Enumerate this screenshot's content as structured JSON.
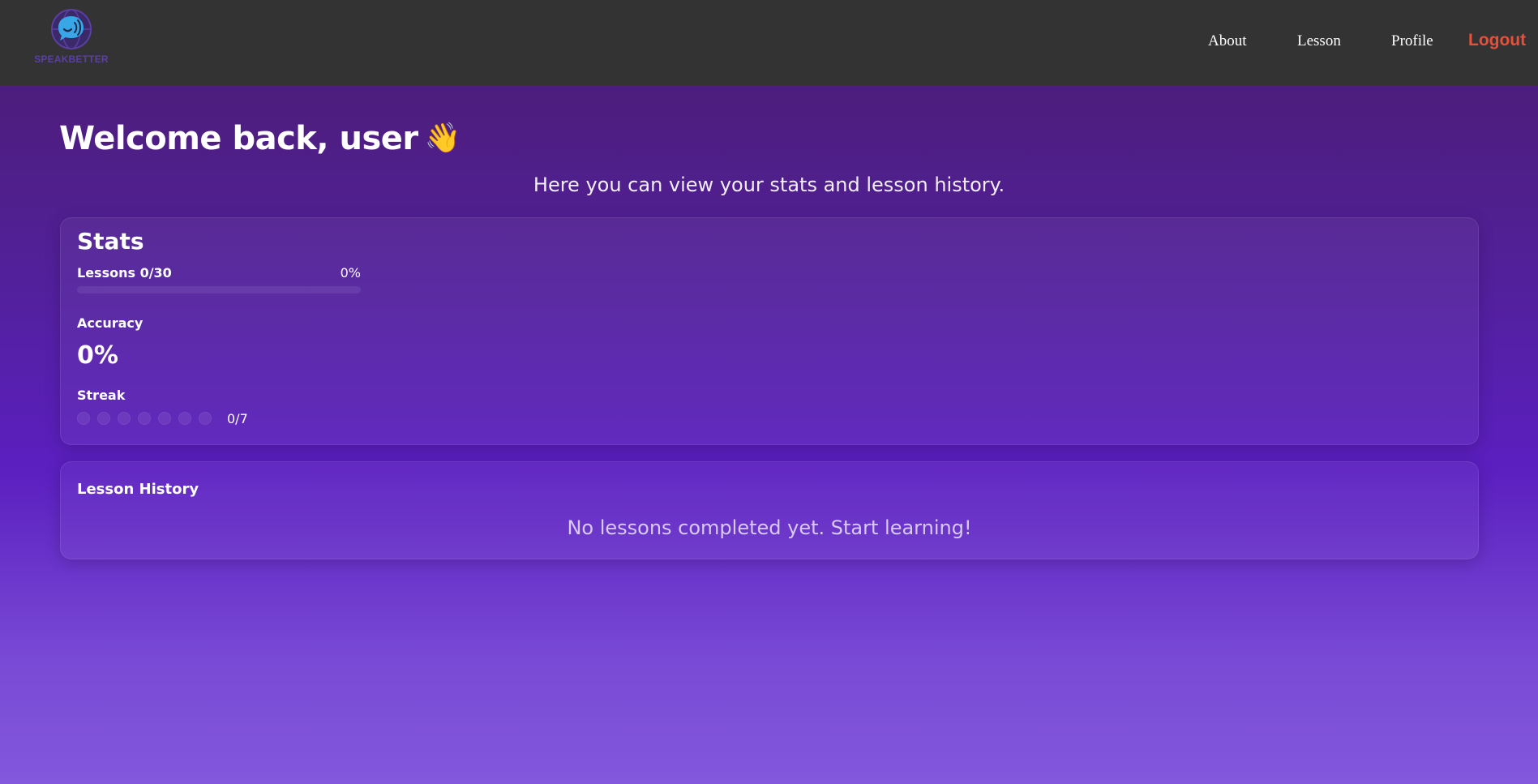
{
  "header": {
    "logo_text": "SPEAKBETTER",
    "nav": {
      "about": "About",
      "lesson": "Lesson",
      "profile": "Profile",
      "logout": "Logout"
    },
    "colors": {
      "background": "#333333",
      "logout": "#e8503a",
      "logo_text": "#5b3fa3"
    }
  },
  "greeting": {
    "title": "Welcome back, user",
    "wave_icon": "👋",
    "subtitle": "Here you can view your stats and lesson history."
  },
  "stats": {
    "title": "Stats",
    "lessons_label": "Lessons 0/30",
    "lessons_percent_text": "0%",
    "lessons_progress_fraction": 0,
    "accuracy_label": "Accuracy",
    "accuracy_value": "0%",
    "streak_label": "Streak",
    "streak_days_total": 7,
    "streak_days_done": 0,
    "streak_count_text": "0/7"
  },
  "history": {
    "title": "Lesson History",
    "empty_message": "No lessons completed yet. Start learning!"
  },
  "icons": {
    "logo": "chat-bubble-speaker-globe-icon",
    "wave": "waving-hand-icon"
  }
}
